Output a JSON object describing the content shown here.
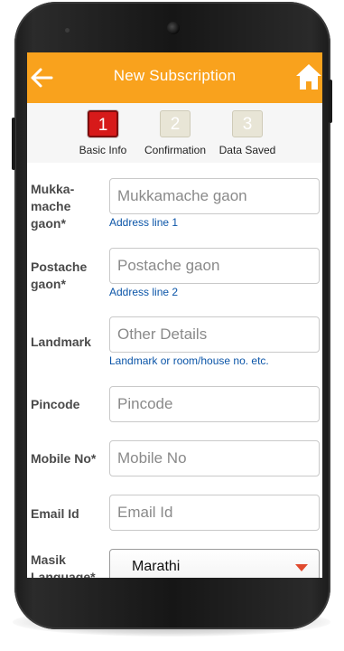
{
  "header": {
    "title": "New Subscription",
    "back_icon": "arrow-left-icon",
    "home_icon": "home-icon",
    "color": "#f9a21d"
  },
  "steps": [
    {
      "number": "1",
      "label": "Basic Info",
      "state": "active"
    },
    {
      "number": "2",
      "label": "Confirmation",
      "state": "inactive"
    },
    {
      "number": "3",
      "label": "Data Saved",
      "state": "inactive"
    }
  ],
  "form": {
    "village": {
      "label": "Mukka-mache gaon*",
      "placeholder": "Mukkamache gaon",
      "value": "",
      "hint": "Address line 1"
    },
    "post": {
      "label": "Postache gaon*",
      "placeholder": "Postache gaon",
      "value": "",
      "hint": "Address line 2"
    },
    "landmark": {
      "label": "Landmark",
      "placeholder": "Other Details",
      "value": "",
      "hint": "Landmark or room/house no. etc."
    },
    "pincode": {
      "label": "Pincode",
      "placeholder": "Pincode",
      "value": ""
    },
    "mobile": {
      "label": "Mobile No*",
      "placeholder": "Mobile No",
      "value": ""
    },
    "email": {
      "label": "Email Id",
      "placeholder": "Email Id",
      "value": ""
    },
    "language": {
      "label": "Masik Language*",
      "selected": "Marathi"
    }
  }
}
